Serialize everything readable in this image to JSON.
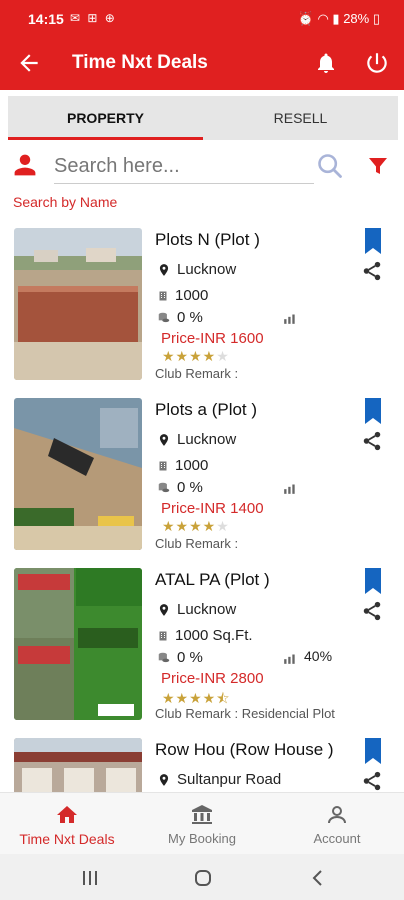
{
  "status_bar": {
    "time": "14:15",
    "battery": "28%"
  },
  "app_bar": {
    "title": "Time Nxt Deals"
  },
  "tabs": [
    {
      "label": "PROPERTY",
      "active": true
    },
    {
      "label": "RESELL",
      "active": false
    }
  ],
  "search": {
    "placeholder": "Search here...",
    "hint": "Search by Name"
  },
  "listings": [
    {
      "title": "Plots N (Plot )",
      "location": "Lucknow",
      "area": "1000",
      "percent": "0 %",
      "tenure": "",
      "price": "Price-INR 1600",
      "rating": 4,
      "remark": "Club Remark :"
    },
    {
      "title": "Plots a (Plot )",
      "location": "Lucknow",
      "area": "1000",
      "percent": "0 %",
      "tenure": "",
      "price": "Price-INR 1400",
      "rating": 4,
      "remark": "Club Remark :"
    },
    {
      "title": "ATAL PA (Plot )",
      "location": "Lucknow",
      "area": "1000 Sq.Ft.",
      "percent": "0 %",
      "tenure": "40%",
      "price": "Price-INR 2800",
      "rating": 4.5,
      "remark": "Club Remark : Residencial Plot"
    },
    {
      "title": "Row Hou (Row House )",
      "location": "Sultanpur Road",
      "area": "",
      "percent": "",
      "tenure": "",
      "price": "",
      "rating": 0,
      "remark": ""
    }
  ],
  "bottom_nav": [
    {
      "label": "Time Nxt Deals",
      "icon": "home-icon",
      "active": true
    },
    {
      "label": "My Booking",
      "icon": "bank-icon",
      "active": false
    },
    {
      "label": "Account",
      "icon": "person-icon",
      "active": false
    }
  ],
  "colors": {
    "primary": "#e02020",
    "price": "#d42a2a",
    "star": "#c9a23a",
    "bookmark": "#1565c0"
  }
}
